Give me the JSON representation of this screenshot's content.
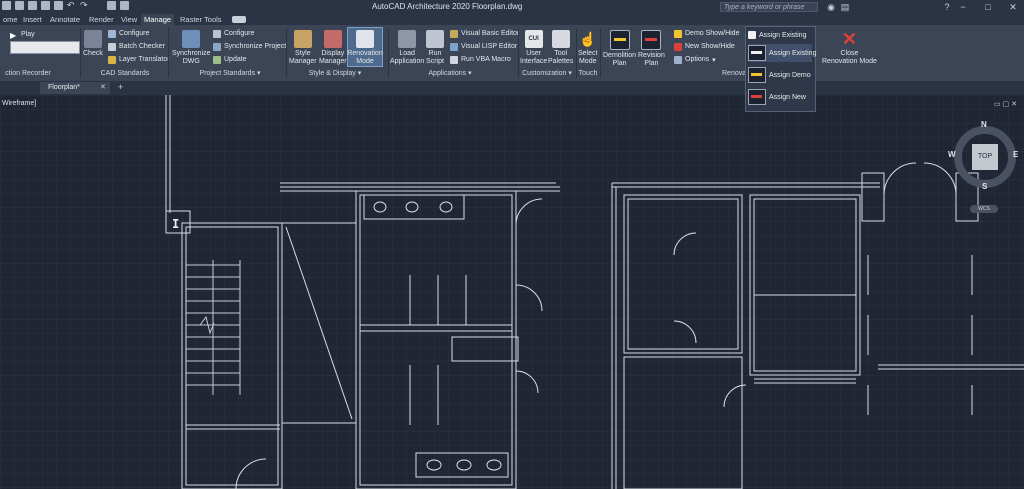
{
  "window": {
    "title": "AutoCAD Architecture 2020    Floorplan.dwg",
    "search_placeholder": "Type a keyword or phrase"
  },
  "ribbon_tabs": [
    "ome",
    "Insert",
    "Annotate",
    "Render",
    "View",
    "Manage",
    "Raster Tools"
  ],
  "active_tab": "Manage",
  "ribbon": {
    "action_recorder": {
      "play": "Play",
      "label": "ction Recorder"
    },
    "cad_standards": {
      "check": "Check",
      "configure": "Configure",
      "batch_checker": "Batch Checker",
      "layer_translator": "Layer Translator",
      "label": "CAD Standards"
    },
    "project_standards": {
      "synchronize_dwg": "Synchronize\nDWG",
      "configure": "Configure",
      "synchronize_project": "Synchronize Project",
      "update": "Update",
      "label": "Project Standards"
    },
    "style_display": {
      "style_manager": "Style\nManager",
      "display_manager": "Display\nManager",
      "renovation_mode": "Renovation\nMode",
      "label": "Style & Display"
    },
    "applications": {
      "load_application": "Load\nApplication",
      "run_script": "Run\nScript",
      "vb_editor": "Visual Basic Editor",
      "vlisp_editor": "Visual LISP Editor",
      "run_vba": "Run VBA Macro",
      "label": "Applications"
    },
    "customization": {
      "user_interface": "User\nInterface",
      "tool_palettes": "Tool\nPalettes",
      "label": "Customization"
    },
    "touch": {
      "select_mode": "Select\nMode",
      "label": "Touch"
    },
    "renovation": {
      "demolition_plan": "Demolition\nPlan",
      "revision_plan": "Revision\nPlan",
      "demo_show_hide": "Demo Show/Hide",
      "new_show_hide": "New Show/Hide",
      "options": "Options",
      "assign_existing": "Assign Existing",
      "close": "Close\nRenovation Mode",
      "label": "Renova"
    }
  },
  "dropdown": {
    "items": [
      "Assign Existing",
      "Assign Demo",
      "Assign New"
    ]
  },
  "file_tab": "Floorplan*",
  "viewport": {
    "view_label": "Wireframe]",
    "viewcube": {
      "top": "TOP",
      "n": "N",
      "s": "S",
      "e": "E",
      "w": "W",
      "wcs": "WCS"
    }
  },
  "colors": {
    "accent_yellow": "#f2c431",
    "accent_red": "#d8413c",
    "close_red": "#e0403a",
    "background": "#202633"
  }
}
